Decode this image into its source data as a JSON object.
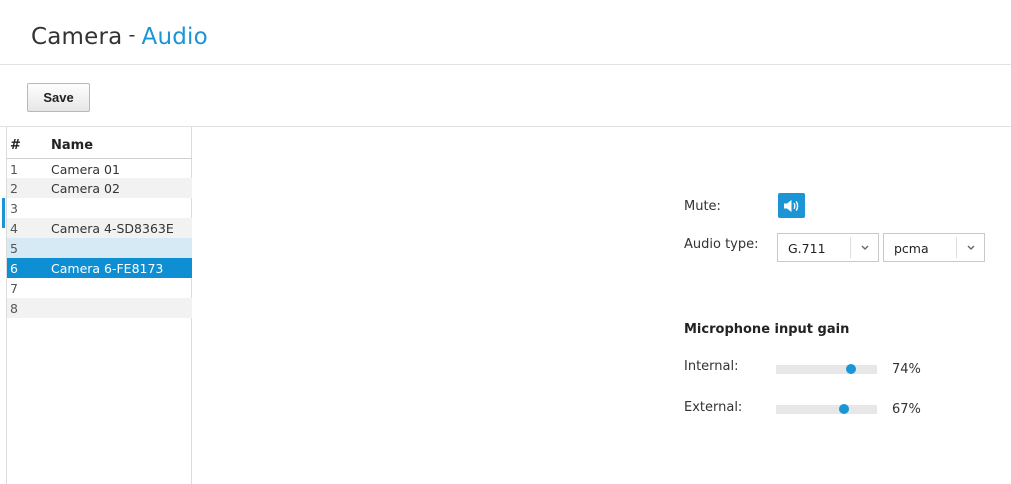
{
  "header": {
    "title_main": "Camera",
    "title_separator": "-",
    "title_section": "Audio"
  },
  "toolbar": {
    "save_label": "Save"
  },
  "camera_table": {
    "col_number": "#",
    "col_name": "Name",
    "rows": [
      {
        "num": "1",
        "name": "Camera 01"
      },
      {
        "num": "2",
        "name": "Camera 02"
      },
      {
        "num": "3",
        "name": ""
      },
      {
        "num": "4",
        "name": "Camera 4-SD8363E"
      },
      {
        "num": "5",
        "name": ""
      },
      {
        "num": "6",
        "name": "Camera 6-FE8173"
      },
      {
        "num": "7",
        "name": ""
      },
      {
        "num": "8",
        "name": ""
      }
    ],
    "selected_row": "6",
    "hovered_row": "5"
  },
  "audio": {
    "mute_label": "Mute:",
    "mute_icon": "speaker-on-icon",
    "audio_type_label": "Audio type:",
    "codec_value": "G.711",
    "encoding_value": "pcma",
    "gain_heading": "Microphone input gain",
    "internal_label": "Internal:",
    "internal_value": "74%",
    "internal_level": 0.74,
    "external_label": "External:",
    "external_value": "67%",
    "external_level": 0.67
  },
  "colors": {
    "accent": "#1a95d6",
    "selected_row": "#0e8fd3",
    "hover_row": "#d6eaf6"
  }
}
